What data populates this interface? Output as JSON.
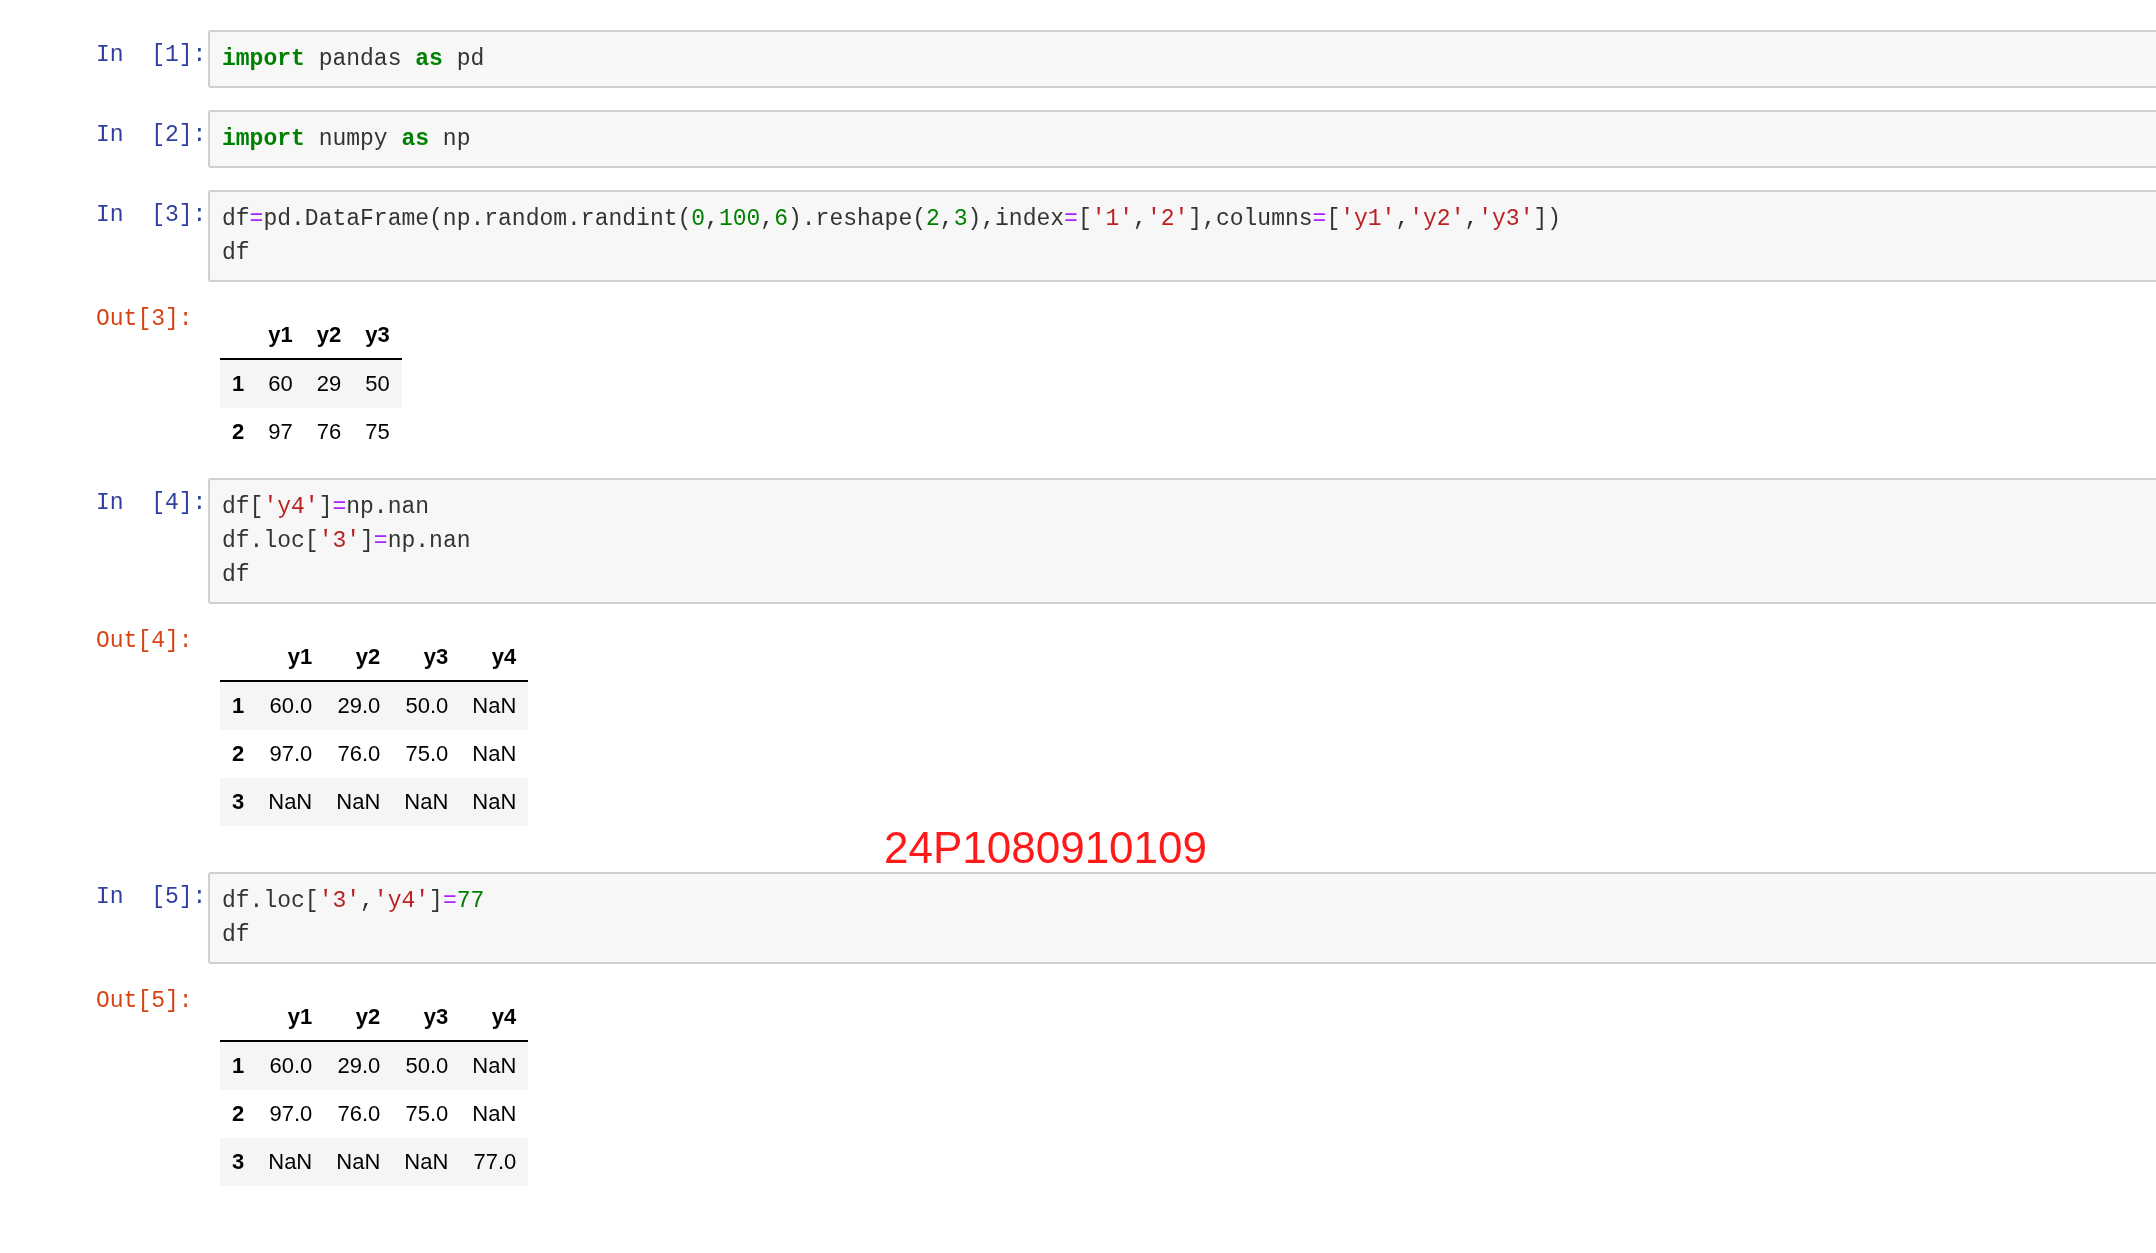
{
  "cells": [
    {
      "prompt": "In  [1]:",
      "code": [
        [
          {
            "kind": "keyword",
            "text": "import"
          },
          {
            "kind": "plain",
            "text": " pandas "
          },
          {
            "kind": "keyword",
            "text": "as"
          },
          {
            "kind": "plain",
            "text": " pd"
          }
        ]
      ]
    },
    {
      "prompt": "In  [2]:",
      "code": [
        [
          {
            "kind": "keyword",
            "text": "import"
          },
          {
            "kind": "plain",
            "text": " numpy "
          },
          {
            "kind": "keyword",
            "text": "as"
          },
          {
            "kind": "plain",
            "text": " np"
          }
        ]
      ]
    },
    {
      "prompt": "In  [3]:",
      "code": [
        [
          {
            "kind": "plain",
            "text": "df"
          },
          {
            "kind": "operator",
            "text": "="
          },
          {
            "kind": "plain",
            "text": "pd.DataFrame(np.random.randint("
          },
          {
            "kind": "number",
            "text": "0"
          },
          {
            "kind": "plain",
            "text": ","
          },
          {
            "kind": "number",
            "text": "100"
          },
          {
            "kind": "plain",
            "text": ","
          },
          {
            "kind": "number",
            "text": "6"
          },
          {
            "kind": "plain",
            "text": ").reshape("
          },
          {
            "kind": "number",
            "text": "2"
          },
          {
            "kind": "plain",
            "text": ","
          },
          {
            "kind": "number",
            "text": "3"
          },
          {
            "kind": "plain",
            "text": "),index"
          },
          {
            "kind": "operator",
            "text": "="
          },
          {
            "kind": "plain",
            "text": "["
          },
          {
            "kind": "string",
            "text": "'1'"
          },
          {
            "kind": "plain",
            "text": ","
          },
          {
            "kind": "string",
            "text": "'2'"
          },
          {
            "kind": "plain",
            "text": "],columns"
          },
          {
            "kind": "operator",
            "text": "="
          },
          {
            "kind": "plain",
            "text": "["
          },
          {
            "kind": "string",
            "text": "'y1'"
          },
          {
            "kind": "plain",
            "text": ","
          },
          {
            "kind": "string",
            "text": "'y2'"
          },
          {
            "kind": "plain",
            "text": ","
          },
          {
            "kind": "string",
            "text": "'y3'"
          },
          {
            "kind": "plain",
            "text": "])"
          }
        ],
        [
          {
            "kind": "plain",
            "text": "df"
          }
        ]
      ],
      "output": {
        "prompt": "Out[3]:",
        "columns": [
          "y1",
          "y2",
          "y3"
        ],
        "rows": [
          {
            "index": "1",
            "values": [
              "60",
              "29",
              "50"
            ]
          },
          {
            "index": "2",
            "values": [
              "97",
              "76",
              "75"
            ]
          }
        ]
      }
    },
    {
      "prompt": "In  [4]:",
      "code": [
        [
          {
            "kind": "plain",
            "text": "df["
          },
          {
            "kind": "string",
            "text": "'y4'"
          },
          {
            "kind": "plain",
            "text": "]"
          },
          {
            "kind": "operator",
            "text": "="
          },
          {
            "kind": "plain",
            "text": "np.nan"
          }
        ],
        [
          {
            "kind": "plain",
            "text": "df.loc["
          },
          {
            "kind": "string",
            "text": "'3'"
          },
          {
            "kind": "plain",
            "text": "]"
          },
          {
            "kind": "operator",
            "text": "="
          },
          {
            "kind": "plain",
            "text": "np.nan"
          }
        ],
        [
          {
            "kind": "plain",
            "text": "df"
          }
        ]
      ],
      "output": {
        "prompt": "Out[4]:",
        "columns": [
          "y1",
          "y2",
          "y3",
          "y4"
        ],
        "rows": [
          {
            "index": "1",
            "values": [
              "60.0",
              "29.0",
              "50.0",
              "NaN"
            ]
          },
          {
            "index": "2",
            "values": [
              "97.0",
              "76.0",
              "75.0",
              "NaN"
            ]
          },
          {
            "index": "3",
            "values": [
              "NaN",
              "NaN",
              "NaN",
              "NaN"
            ]
          }
        ]
      }
    },
    {
      "prompt": "In  [5]:",
      "code": [
        [
          {
            "kind": "plain",
            "text": "df.loc["
          },
          {
            "kind": "string",
            "text": "'3'"
          },
          {
            "kind": "plain",
            "text": ","
          },
          {
            "kind": "string",
            "text": "'y4'"
          },
          {
            "kind": "plain",
            "text": "]"
          },
          {
            "kind": "operator",
            "text": "="
          },
          {
            "kind": "number",
            "text": "77"
          }
        ],
        [
          {
            "kind": "plain",
            "text": "df"
          }
        ]
      ],
      "output": {
        "prompt": "Out[5]:",
        "columns": [
          "y1",
          "y2",
          "y3",
          "y4"
        ],
        "rows": [
          {
            "index": "1",
            "values": [
              "60.0",
              "29.0",
              "50.0",
              "NaN"
            ]
          },
          {
            "index": "2",
            "values": [
              "97.0",
              "76.0",
              "75.0",
              "NaN"
            ]
          },
          {
            "index": "3",
            "values": [
              "NaN",
              "NaN",
              "NaN",
              "77.0"
            ]
          }
        ]
      }
    }
  ],
  "annotation": "24P1080910109"
}
